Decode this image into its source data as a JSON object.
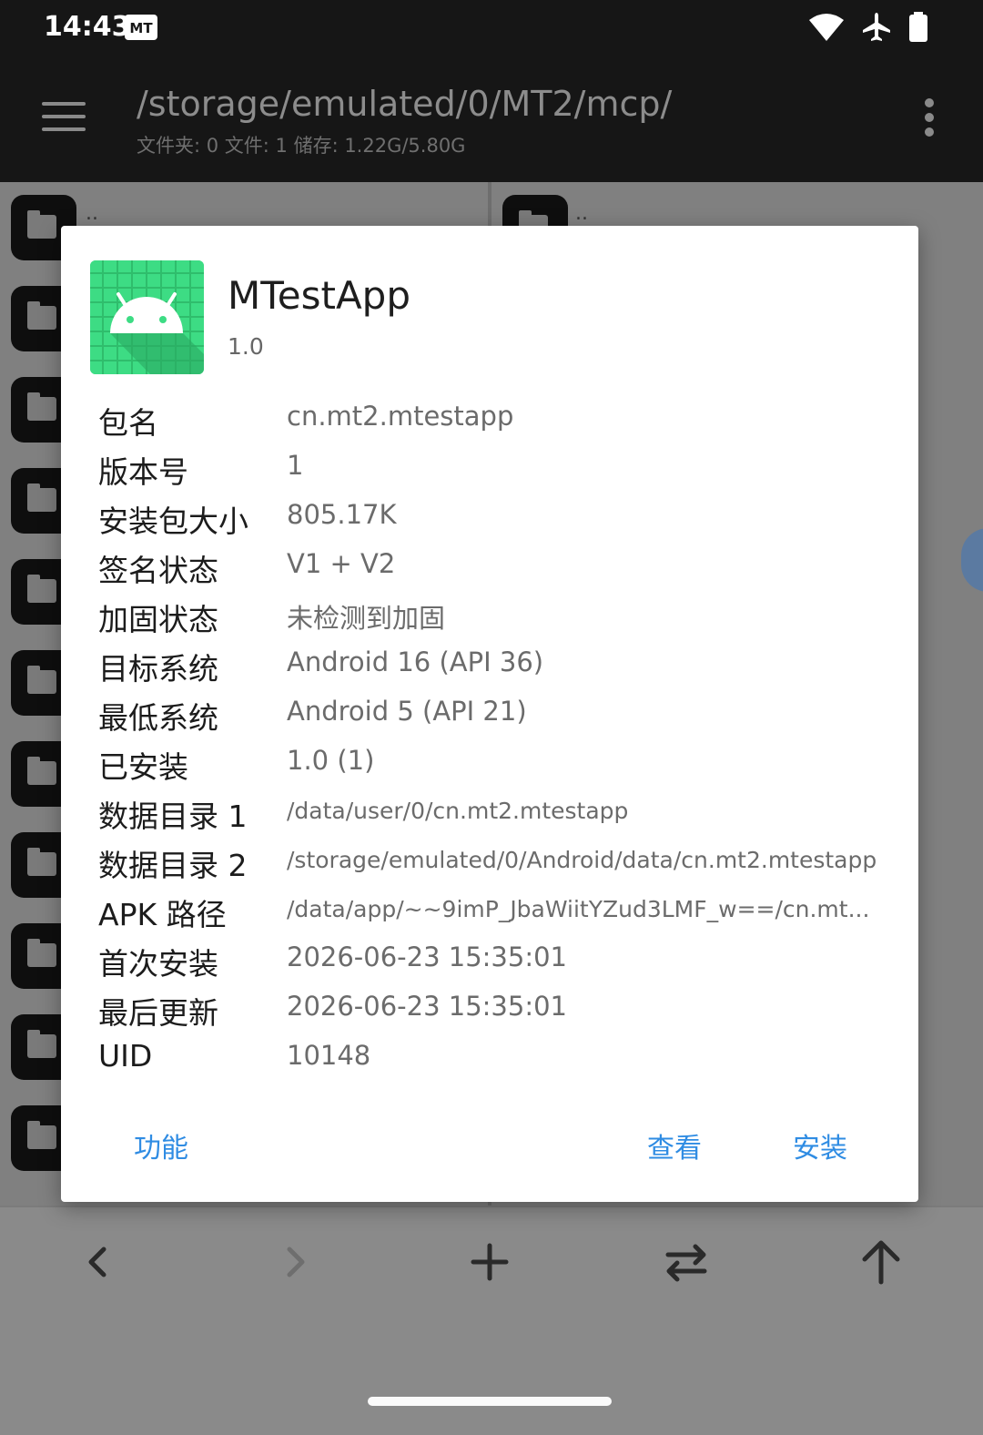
{
  "status_bar": {
    "time": "14:43",
    "badge": "MT",
    "icons": [
      "wifi-icon",
      "airplane-icon",
      "battery-icon"
    ]
  },
  "toolbar": {
    "path": "/storage/emulated/0/MT2/mcp/",
    "summary": "文件夹: 0  文件: 1  储存: 1.22G/5.80G"
  },
  "panes": {
    "left_parent_label": "..",
    "right_parent_label": ".."
  },
  "dialog": {
    "app_name": "MTestApp",
    "app_version": "1.0",
    "rows": [
      {
        "label": "包名",
        "value": "cn.mt2.mtestapp"
      },
      {
        "label": "版本号",
        "value": "1"
      },
      {
        "label": "安装包大小",
        "value": "805.17K"
      },
      {
        "label": "签名状态",
        "value": "V1 + V2"
      },
      {
        "label": "加固状态",
        "value": "未检测到加固"
      },
      {
        "label": "目标系统",
        "value": "Android 16 (API 36)"
      },
      {
        "label": "最低系统",
        "value": "Android 5 (API 21)"
      },
      {
        "label": "已安装",
        "value": "1.0 (1)"
      },
      {
        "label": "数据目录 1",
        "value": "/data/user/0/cn.mt2.mtestapp"
      },
      {
        "label": "数据目录 2",
        "value": "/storage/emulated/0/Android/data/cn.mt2.mtestapp"
      },
      {
        "label": "APK 路径",
        "value": "/data/app/~~9imP_JbaWiitYZud3LMF_w==/cn.mt..."
      },
      {
        "label": "首次安装",
        "value": "2026-06-23 15:35:01"
      },
      {
        "label": "最后更新",
        "value": "2026-06-23 15:35:01"
      },
      {
        "label": "UID",
        "value": "10148"
      }
    ],
    "buttons": {
      "functions": "功能",
      "view": "查看",
      "install": "安装"
    }
  },
  "colors": {
    "accent": "#2f8ce3",
    "app_icon_bg": "#3ddc84",
    "toolbar_bg": "#161616"
  }
}
